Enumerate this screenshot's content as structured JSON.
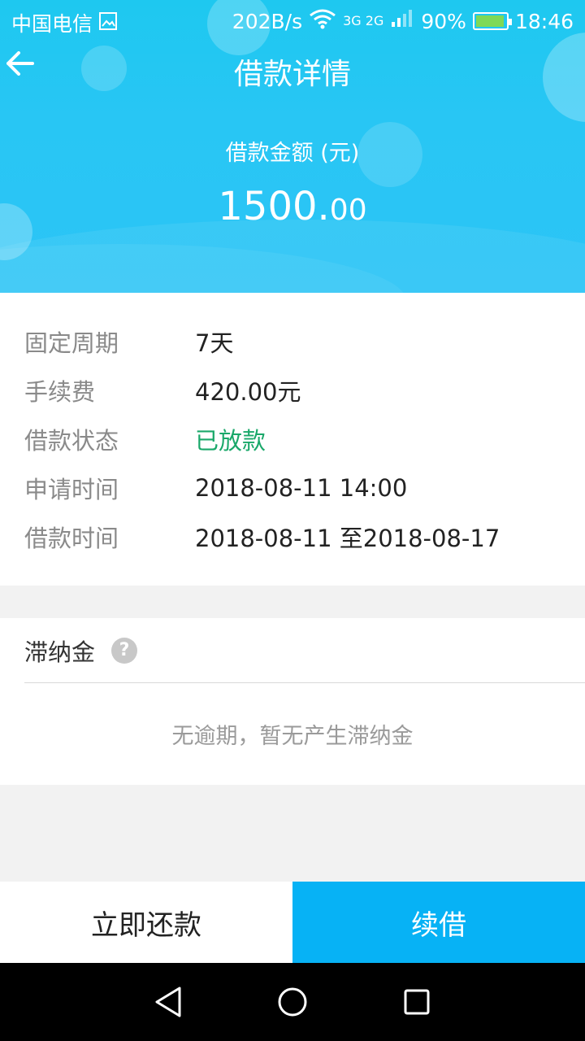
{
  "status_bar": {
    "carrier": "中国电信",
    "net_speed": "202B/s",
    "network_types": "3G 2G",
    "battery": "90%",
    "time": "18:46",
    "icons": [
      "image-icon",
      "wifi-icon",
      "signal-icon",
      "battery-icon"
    ]
  },
  "header": {
    "title": "借款详情",
    "amount_label": "借款金额 (元)",
    "amount_integer": "1500.",
    "amount_decimal": "00",
    "back_icon": "arrow-left-icon"
  },
  "details": {
    "rows": [
      {
        "label": "固定周期",
        "value": "7天"
      },
      {
        "label": "手续费",
        "value": "420.00元"
      },
      {
        "label": "借款状态",
        "value": "已放款"
      },
      {
        "label": "申请时间",
        "value": "2018-08-11 14:00"
      },
      {
        "label": "借款时间",
        "value": "2018-08-11 至2018-08-17"
      }
    ],
    "status_color": "#1aa86a"
  },
  "late_fee": {
    "title": "滞纳金",
    "help_icon": "?",
    "message": "无逾期，暂无产生滞纳金"
  },
  "actions": {
    "repay_label": "立即还款",
    "renew_label": "续借",
    "renew_color": "#07b2f5"
  },
  "nav": {
    "icons": [
      "back-triangle-icon",
      "home-circle-icon",
      "recents-square-icon"
    ]
  }
}
